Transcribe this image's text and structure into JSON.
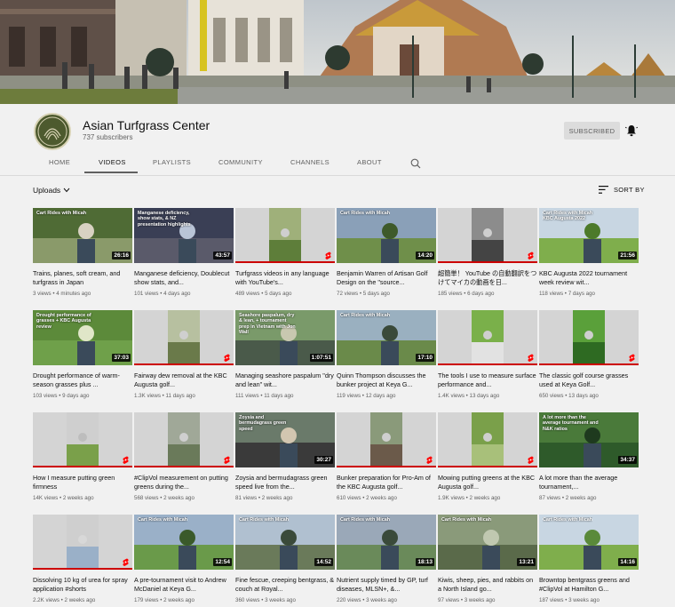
{
  "channel": {
    "name": "Asian Turfgrass Center",
    "subscribers": "737 subscribers",
    "subscribe_label": "SUBSCRIBED"
  },
  "tabs": [
    {
      "label": "HOME",
      "active": false
    },
    {
      "label": "VIDEOS",
      "active": true
    },
    {
      "label": "PLAYLISTS",
      "active": false
    },
    {
      "label": "COMMUNITY",
      "active": false
    },
    {
      "label": "CHANNELS",
      "active": false
    },
    {
      "label": "ABOUT",
      "active": false
    }
  ],
  "toolbar": {
    "uploads_label": "Uploads",
    "sort_label": "SORT BY"
  },
  "videos": [
    {
      "title": "Trains, planes, soft cream, and turfgrass in Japan",
      "views": "3 views",
      "age": "4 minutes ago",
      "duration": "26:16",
      "shorts": false,
      "overlay": "Cart Rides with Micah",
      "progress": 0
    },
    {
      "title": "Manganese deficiency, Doublecut show stats, and...",
      "views": "101 views",
      "age": "4 days ago",
      "duration": "43:57",
      "shorts": false,
      "overlay": "Manganese deficiency, show stats, & NZ presentation highlights",
      "progress": 0
    },
    {
      "title": "Turfgrass videos in any language with YouTube's...",
      "views": "489 views",
      "age": "5 days ago",
      "duration": "",
      "shorts": true,
      "overlay": "",
      "progress": 1
    },
    {
      "title": "Benjamin Warren of Artisan Golf Design on the \"source...",
      "views": "72 views",
      "age": "5 days ago",
      "duration": "14:20",
      "shorts": false,
      "overlay": "Cart Rides with Micah",
      "progress": 0
    },
    {
      "title": "超簡単！ YouTube の自動翻訳をつけてマイカの動画を日...",
      "views": "185 views",
      "age": "6 days ago",
      "duration": "",
      "shorts": true,
      "overlay": "",
      "progress": 1
    },
    {
      "title": "KBC Augusta 2022 tournament week review wit...",
      "views": "118 views",
      "age": "7 days ago",
      "duration": "21:56",
      "shorts": false,
      "overlay": "Cart Rides with Micah KBC Augusta 2022",
      "progress": 0
    },
    {
      "title": "Drought performance of warm-season grasses plus ...",
      "views": "103 views",
      "age": "9 days ago",
      "duration": "37:03",
      "shorts": false,
      "overlay": "Drought performance of grasses + KBC Augusta review",
      "progress": 0
    },
    {
      "title": "Fairway dew removal at the KBC Augusta golf...",
      "views": "1.3K views",
      "age": "11 days ago",
      "duration": "",
      "shorts": true,
      "overlay": "",
      "progress": 1
    },
    {
      "title": "Managing seashore paspalum \"dry and lean\" wit...",
      "views": "111 views",
      "age": "11 days ago",
      "duration": "1:07:51",
      "shorts": false,
      "overlay": "Seashore paspalum, dry & lean, + tournament prep in Vietnam with Jon Wall",
      "progress": 0
    },
    {
      "title": "Quinn Thompson discusses the bunker project at Keya G...",
      "views": "119 views",
      "age": "12 days ago",
      "duration": "17:10",
      "shorts": false,
      "overlay": "Cart Rides with Micah",
      "progress": 0
    },
    {
      "title": "The tools I use to measure surface performance and...",
      "views": "1.4K views",
      "age": "13 days ago",
      "duration": "",
      "shorts": true,
      "overlay": "",
      "progress": 1
    },
    {
      "title": "The classic golf course grasses used at Keya Golf...",
      "views": "650 views",
      "age": "13 days ago",
      "duration": "",
      "shorts": true,
      "overlay": "",
      "progress": 1
    },
    {
      "title": "How I measure putting green firmness",
      "views": "14K views",
      "age": "2 weeks ago",
      "duration": "",
      "shorts": true,
      "overlay": "",
      "progress": 1
    },
    {
      "title": "#ClipVol measurement on putting greens during the...",
      "views": "568 views",
      "age": "2 weeks ago",
      "duration": "",
      "shorts": true,
      "overlay": "",
      "progress": 1
    },
    {
      "title": "Zoysia and bermudagrass green speed live from the...",
      "views": "81 views",
      "age": "2 weeks ago",
      "duration": "30:27",
      "shorts": false,
      "overlay": "Zoysia and bermudagrass green speed",
      "progress": 0
    },
    {
      "title": "Bunker preparation for Pro-Am of the KBC Augusta golf...",
      "views": "610 views",
      "age": "2 weeks ago",
      "duration": "",
      "shorts": true,
      "overlay": "",
      "progress": 1
    },
    {
      "title": "Mowing putting greens at the KBC Augusta golf...",
      "views": "1.9K views",
      "age": "2 weeks ago",
      "duration": "",
      "shorts": true,
      "overlay": "",
      "progress": 1
    },
    {
      "title": "A lot more than the average tournament,...",
      "views": "87 views",
      "age": "2 weeks ago",
      "duration": "34:37",
      "shorts": false,
      "overlay": "A lot more than the average tournament and N&K ratios",
      "progress": 0
    },
    {
      "title": "Dissolving 10 kg of urea for spray application #shorts",
      "views": "2.2K views",
      "age": "2 weeks ago",
      "duration": "",
      "shorts": true,
      "overlay": "",
      "progress": 1
    },
    {
      "title": "A pre-tournament visit to Andrew McDaniel at Keya G...",
      "views": "179 views",
      "age": "2 weeks ago",
      "duration": "12:54",
      "shorts": false,
      "overlay": "Cart Rides with Micah",
      "progress": 0
    },
    {
      "title": "Fine fescue, creeping bentgrass, & couch at Royal...",
      "views": "360 views",
      "age": "3 weeks ago",
      "duration": "14:52",
      "shorts": false,
      "overlay": "Cart Rides with Micah",
      "progress": 0
    },
    {
      "title": "Nutrient supply timed by GP, turf diseases, MLSN+, &...",
      "views": "220 views",
      "age": "3 weeks ago",
      "duration": "18:13",
      "shorts": false,
      "overlay": "Cart Rides with Micah",
      "progress": 0
    },
    {
      "title": "Kiwis, sheep, pies, and rabbits on a North Island go...",
      "views": "97 views",
      "age": "3 weeks ago",
      "duration": "13:21",
      "shorts": false,
      "overlay": "Cart Rides with Micah",
      "progress": 0
    },
    {
      "title": "Browntop bentgrass greens and #ClipVol at Hamilton G...",
      "views": "187 views",
      "age": "3 weeks ago",
      "duration": "14:16",
      "shorts": false,
      "overlay": "Cart Rides with Micah",
      "progress": 0
    }
  ],
  "colors": {
    "accent_red": "#cc0000",
    "background": "#f1f1f1"
  }
}
